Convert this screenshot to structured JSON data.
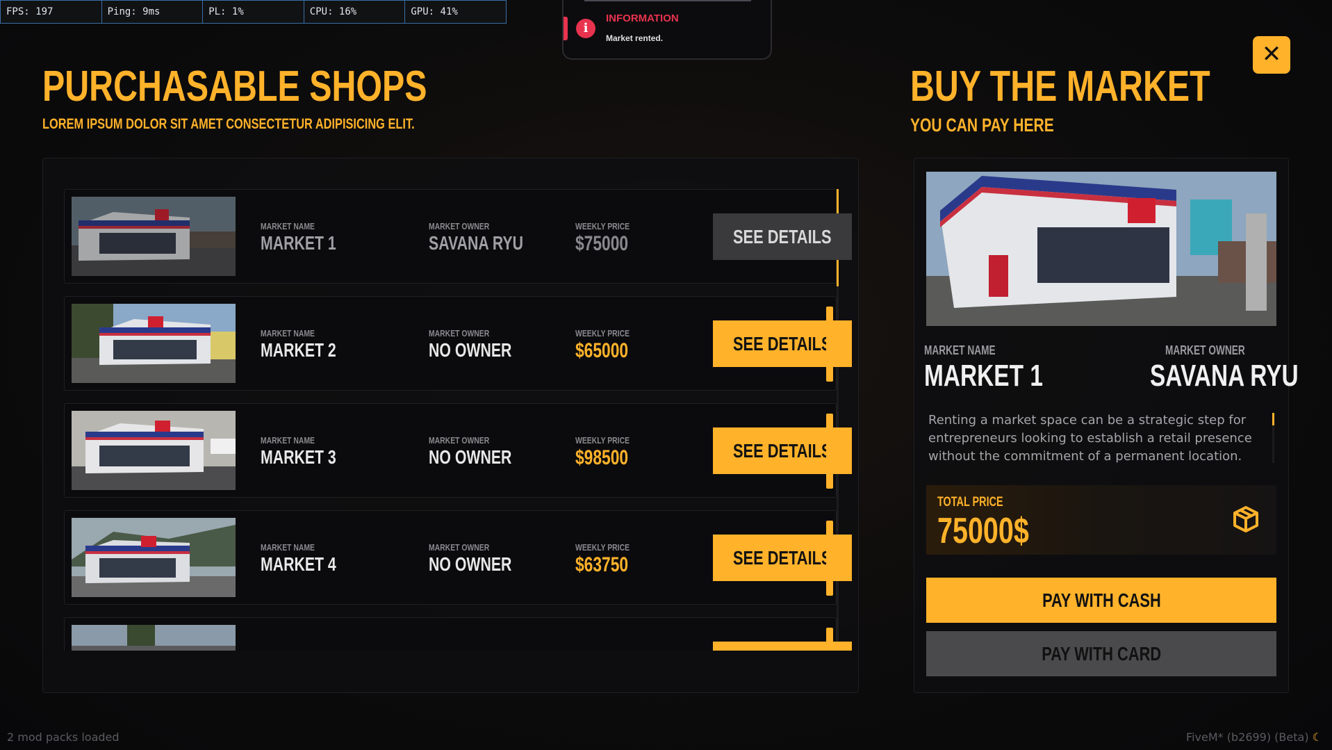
{
  "stats": {
    "fps": "FPS: 197",
    "ping": "Ping: 9ms",
    "pl": "PL: 1%",
    "cpu": "CPU: 16%",
    "gpu": "GPU: 41%"
  },
  "notification": {
    "title": "INFORMATION",
    "message": "Market rented.",
    "icon": "info-icon",
    "color": "#e8334f"
  },
  "left": {
    "title": "PURCHASABLE SHOPS",
    "subtitle": "LOREM IPSUM DOLOR SIT AMET CONSECTETUR ADIPISICING ELIT."
  },
  "labels": {
    "market_name": "MARKET NAME",
    "market_owner": "MARKET OWNER",
    "weekly_price": "WEEKLY PRICE",
    "see_details": "SEE DETAILS"
  },
  "markets": [
    {
      "name": "MARKET 1",
      "owner": "SAVANA RYU",
      "price": "$75000"
    },
    {
      "name": "MARKET 2",
      "owner": "NO OWNER",
      "price": "$65000"
    },
    {
      "name": "MARKET 3",
      "owner": "NO OWNER",
      "price": "$98500"
    },
    {
      "name": "MARKET 4",
      "owner": "NO OWNER",
      "price": "$63750"
    }
  ],
  "right": {
    "title": "BUY THE MARKET",
    "subtitle": "YOU CAN PAY HERE",
    "market_name_label": "MARKET NAME",
    "market_name": "MARKET 1",
    "market_owner_label": "MARKET OWNER",
    "market_owner": "SAVANA RYU",
    "description": "Renting a market space can be a strategic step for entrepreneurs looking to establish a retail presence without the commitment of a permanent location. This",
    "total_label": "TOTAL PRICE",
    "total_value": "75000$",
    "pay_cash": "PAY WITH CASH",
    "pay_card": "PAY WITH CARD",
    "close": "✕"
  },
  "footer": {
    "left": "2 mod packs loaded",
    "right": "FiveM* (b2699) (Beta)",
    "moon": "☾"
  },
  "colors": {
    "accent": "#ffb22a",
    "background": "#0d0c0c",
    "button_disabled": "#3a3a3d"
  }
}
